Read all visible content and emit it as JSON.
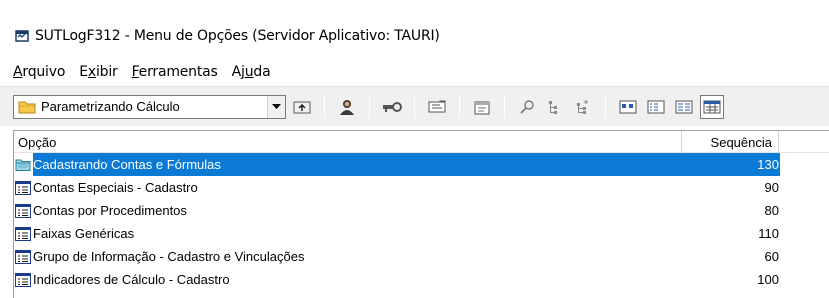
{
  "window": {
    "title": "SUTLogF312 - Menu de Opções (Servidor Aplicativo: TAURI)"
  },
  "menu": [
    {
      "pre": "",
      "acc": "A",
      "post": "rquivo"
    },
    {
      "pre": "E",
      "acc": "x",
      "post": "ibir"
    },
    {
      "pre": "",
      "acc": "F",
      "post": "erramentas"
    },
    {
      "pre": "Aj",
      "acc": "u",
      "post": "da"
    }
  ],
  "toolbar": {
    "combo_value": "Parametrizando Cálculo",
    "icons": [
      "up-folder-icon",
      "user-icon",
      "key-icon",
      "card-icon",
      "properties-icon",
      "find-icon",
      "tree-collapse-icon",
      "tree-expand-icon",
      "large-icons-view-icon",
      "small-icons-view-icon",
      "list-view-icon",
      "details-view-icon"
    ]
  },
  "list": {
    "columns": {
      "option": "Opção",
      "sequence": "Sequência"
    },
    "rows": [
      {
        "label": "Cadastrando Contas e Fórmulas",
        "seq": "130",
        "icon": "folder-icon",
        "selected": true
      },
      {
        "label": "Contas Especiais - Cadastro",
        "seq": "90",
        "icon": "form-icon",
        "selected": false
      },
      {
        "label": "Contas por Procedimentos",
        "seq": "80",
        "icon": "form-icon",
        "selected": false
      },
      {
        "label": "Faixas Genéricas",
        "seq": "110",
        "icon": "form-icon",
        "selected": false
      },
      {
        "label": "Grupo de Informação - Cadastro e Vinculações",
        "seq": "60",
        "icon": "form-icon",
        "selected": false
      },
      {
        "label": "Indicadores de Cálculo - Cadastro",
        "seq": "100",
        "icon": "form-icon",
        "selected": false
      }
    ]
  },
  "colors": {
    "selection": "#0a7ad4",
    "toolbar_bg": "#f0f0f0"
  }
}
